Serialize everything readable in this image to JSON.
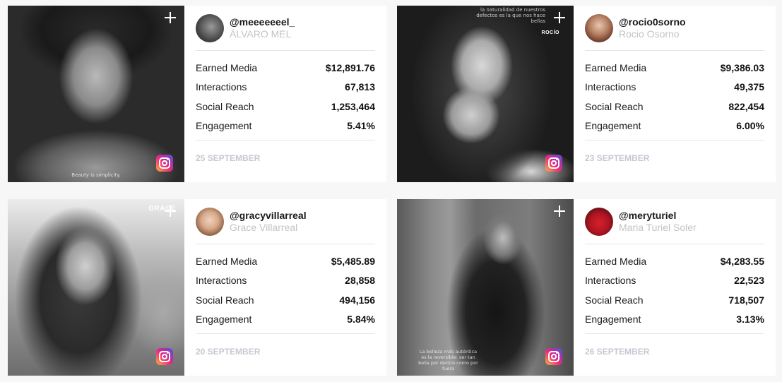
{
  "cards": [
    {
      "handle": "@meeeeeeel_",
      "name": "ÁLVARO MEL",
      "metrics": [
        {
          "label": "Earned Media",
          "value": "$12,891.76"
        },
        {
          "label": "Interactions",
          "value": "67,813"
        },
        {
          "label": "Social Reach",
          "value": "1,253,464"
        },
        {
          "label": "Engagement",
          "value": "5.41%"
        }
      ],
      "date": "25 SEPTEMBER",
      "photo_caption": "Beauty is simplicity.",
      "platform_icon": "instagram-icon"
    },
    {
      "handle": "@rocio0sorno",
      "name": "Rocio Osorno",
      "metrics": [
        {
          "label": "Earned Media",
          "value": "$9,386.03"
        },
        {
          "label": "Interactions",
          "value": "49,375"
        },
        {
          "label": "Social Reach",
          "value": "822,454"
        },
        {
          "label": "Engagement",
          "value": "6.00%"
        }
      ],
      "date": "23 SEPTEMBER",
      "photo_caption": "la naturalidad de nuestros defectos es la que nos hace bellas",
      "photo_brand": "ROCÍO",
      "platform_icon": "instagram-icon"
    },
    {
      "handle": "@gracyvillarreal",
      "name": "Grace Villarreal",
      "metrics": [
        {
          "label": "Earned Media",
          "value": "$5,485.89"
        },
        {
          "label": "Interactions",
          "value": "28,858"
        },
        {
          "label": "Social Reach",
          "value": "494,156"
        },
        {
          "label": "Engagement",
          "value": "5.84%"
        }
      ],
      "date": "20 SEPTEMBER",
      "photo_brand": "GRACE",
      "platform_icon": "instagram-icon"
    },
    {
      "handle": "@meryturiel",
      "name": "Maria Turiel Soler",
      "metrics": [
        {
          "label": "Earned Media",
          "value": "$4,283.55"
        },
        {
          "label": "Interactions",
          "value": "22,523"
        },
        {
          "label": "Social Reach",
          "value": "718,507"
        },
        {
          "label": "Engagement",
          "value": "3.13%"
        }
      ],
      "date": "26 SEPTEMBER",
      "photo_caption": "La belleza más auténtica es la reversible: ser tan bella por dentro como por fuera",
      "platform_icon": "instagram-icon"
    }
  ],
  "colors": {
    "name_gray": "#c3c3c3",
    "date_gray": "#c6c8d2",
    "divider": "#e6e6e6"
  }
}
